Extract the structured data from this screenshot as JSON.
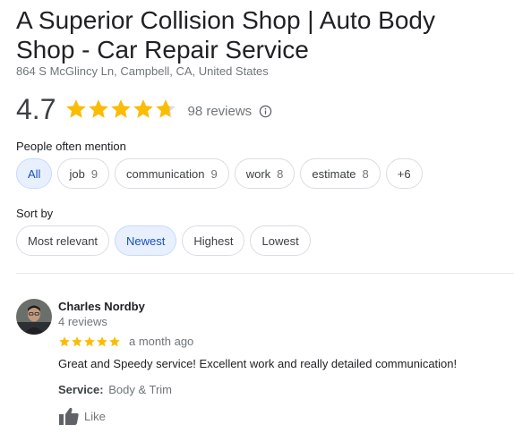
{
  "place": {
    "name": "A Superior Collision Shop | Auto Body Shop - Car Repair Service",
    "address": "864 S McGlincy Ln, Campbell, CA, United States"
  },
  "rating": {
    "value": "4.7",
    "stars_filled": 4.7,
    "reviews_label": "98 reviews",
    "star_color": "#fbbc04",
    "star_empty_color": "#dadce0",
    "info_icon": "info-icon"
  },
  "mentions": {
    "label": "People often mention",
    "chips": [
      {
        "label": "All",
        "count": "",
        "selected": true
      },
      {
        "label": "job",
        "count": "9",
        "selected": false
      },
      {
        "label": "communication",
        "count": "9",
        "selected": false
      },
      {
        "label": "work",
        "count": "8",
        "selected": false
      },
      {
        "label": "estimate",
        "count": "8",
        "selected": false
      },
      {
        "label": "+6",
        "count": "",
        "selected": false
      }
    ]
  },
  "sort": {
    "label": "Sort by",
    "options": [
      {
        "label": "Most relevant",
        "selected": false
      },
      {
        "label": "Newest",
        "selected": true
      },
      {
        "label": "Highest",
        "selected": false
      },
      {
        "label": "Lowest",
        "selected": false
      }
    ]
  },
  "review": {
    "author": "Charles Nordby",
    "author_reviews": "4 reviews",
    "stars": 5,
    "date": "a month ago",
    "text": "Great and Speedy service! Excellent work and really detailed communication!",
    "service_label": "Service:",
    "service_value": "Body & Trim",
    "like_label": "Like",
    "like_icon": "thumbs-up-icon"
  },
  "colors": {
    "selected_chip_bg": "#e8f0fe",
    "selected_chip_text": "#1a4fb8",
    "star": "#fbbc04"
  }
}
